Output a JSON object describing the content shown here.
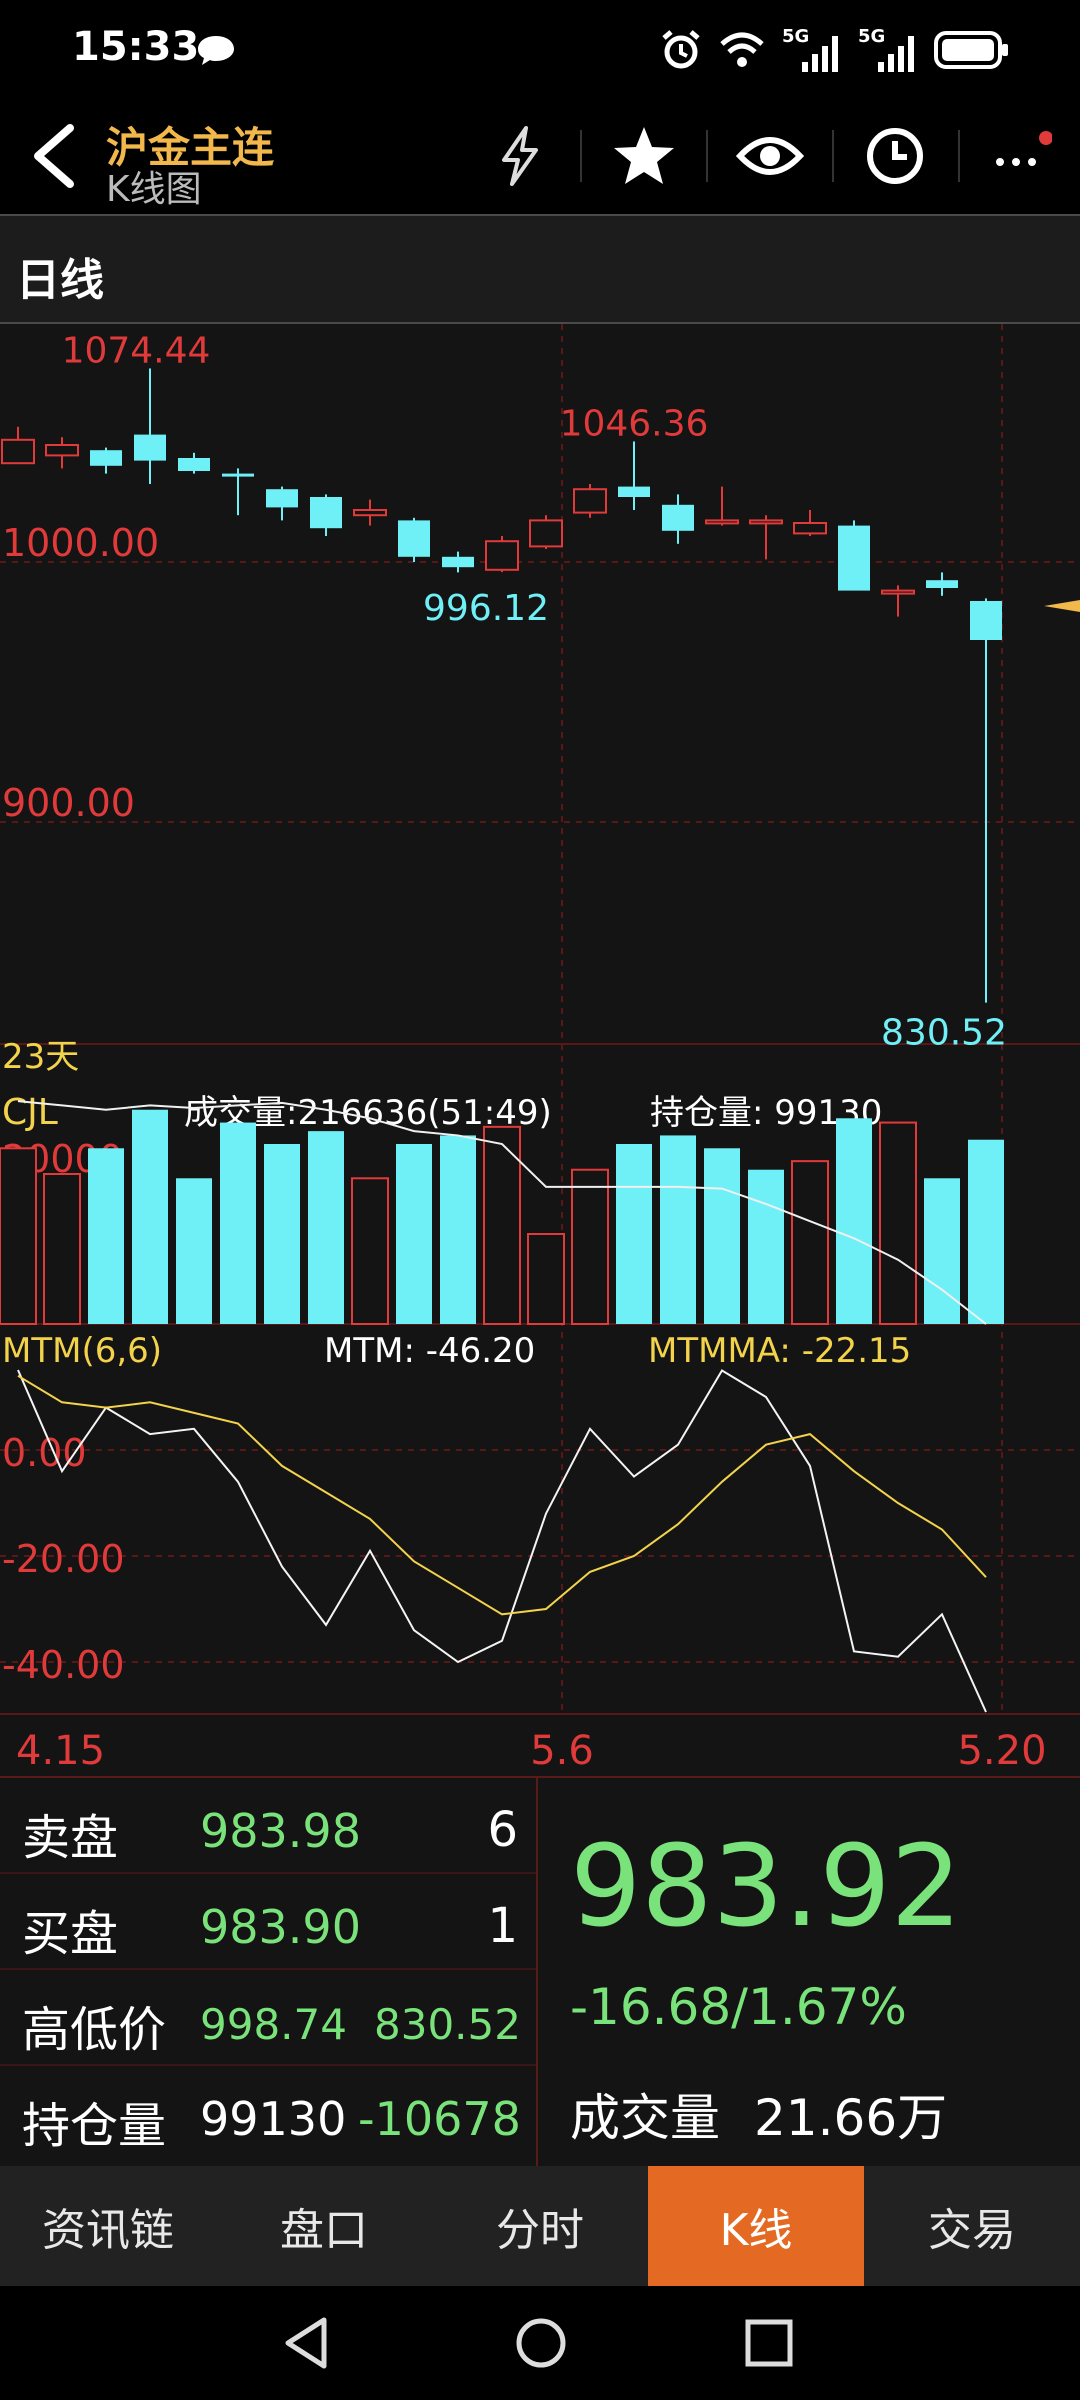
{
  "status_bar": {
    "time": "15:33",
    "net1": "5G",
    "net2": "5G"
  },
  "header": {
    "title": "沪金主连",
    "subtitle": "K线图",
    "icons": [
      "back-icon",
      "lightning-icon",
      "star-icon",
      "eye-icon",
      "clock-icon",
      "more-icon"
    ]
  },
  "period": {
    "label": "日线"
  },
  "chart_data": {
    "type": "candlestick",
    "price_axis": {
      "labels": [
        "1000.00",
        "900.00"
      ],
      "values": [
        1000,
        900
      ]
    },
    "annotations": {
      "high": {
        "text": "1074.44",
        "value": 1074.44,
        "index": 3
      },
      "peak2": {
        "text": "1046.36",
        "value": 1046.36,
        "index": 14
      },
      "low_mid": {
        "text": "996.12",
        "value": 996.12,
        "index": 11
      },
      "low": {
        "text": "830.52",
        "value": 830.52,
        "index": 22
      }
    },
    "days_label": "23天",
    "candles": [
      {
        "o": 1038,
        "h": 1052,
        "l": 1038,
        "c": 1047
      },
      {
        "o": 1041,
        "h": 1048,
        "l": 1036,
        "c": 1045
      },
      {
        "o": 1043,
        "h": 1044,
        "l": 1034,
        "c": 1037
      },
      {
        "o": 1049,
        "h": 1074.44,
        "l": 1030,
        "c": 1039
      },
      {
        "o": 1040,
        "h": 1042,
        "l": 1034,
        "c": 1035
      },
      {
        "o": 1034,
        "h": 1036,
        "l": 1018,
        "c": 1033
      },
      {
        "o": 1028,
        "h": 1029,
        "l": 1016,
        "c": 1021
      },
      {
        "o": 1025,
        "h": 1026,
        "l": 1010,
        "c": 1013
      },
      {
        "o": 1018,
        "h": 1024,
        "l": 1014,
        "c": 1020
      },
      {
        "o": 1016,
        "h": 1017,
        "l": 1000,
        "c": 1002
      },
      {
        "o": 1002,
        "h": 1004,
        "l": 996,
        "c": 998
      },
      {
        "o": 997,
        "h": 1010,
        "l": 996.12,
        "c": 1008
      },
      {
        "o": 1006,
        "h": 1018,
        "l": 1005,
        "c": 1016
      },
      {
        "o": 1019,
        "h": 1030,
        "l": 1017,
        "c": 1028
      },
      {
        "o": 1029,
        "h": 1046.36,
        "l": 1020,
        "c": 1025
      },
      {
        "o": 1022,
        "h": 1026,
        "l": 1007,
        "c": 1012
      },
      {
        "o": 1015,
        "h": 1029,
        "l": 1014,
        "c": 1016
      },
      {
        "o": 1015,
        "h": 1018,
        "l": 1001,
        "c": 1016
      },
      {
        "o": 1011,
        "h": 1020,
        "l": 1010,
        "c": 1015
      },
      {
        "o": 1014,
        "h": 1016,
        "l": 994,
        "c": 989
      },
      {
        "o": 989,
        "h": 991,
        "l": 979,
        "c": 989
      },
      {
        "o": 993,
        "h": 996,
        "l": 987,
        "c": 990
      },
      {
        "o": 985,
        "h": 986,
        "l": 830.52,
        "c": 970
      }
    ],
    "volume": {
      "indicator": "CJL",
      "text": "成交量:216636(51:49)",
      "oi_text": "持仓量: 99130",
      "axis_label": "20000",
      "axis_value": 20000,
      "bars": [
        {
          "v": 20500,
          "up": true
        },
        {
          "v": 17500,
          "up": true
        },
        {
          "v": 20500,
          "up": false
        },
        {
          "v": 25000,
          "up": false
        },
        {
          "v": 17000,
          "up": false
        },
        {
          "v": 23500,
          "up": false
        },
        {
          "v": 21000,
          "up": false
        },
        {
          "v": 22500,
          "up": false
        },
        {
          "v": 17000,
          "up": true
        },
        {
          "v": 21000,
          "up": false
        },
        {
          "v": 22000,
          "up": false
        },
        {
          "v": 23000,
          "up": true
        },
        {
          "v": 10500,
          "up": true
        },
        {
          "v": 18000,
          "up": true
        },
        {
          "v": 21000,
          "up": false
        },
        {
          "v": 22000,
          "up": false
        },
        {
          "v": 20500,
          "up": false
        },
        {
          "v": 18000,
          "up": false
        },
        {
          "v": 19000,
          "up": true
        },
        {
          "v": 24000,
          "up": false
        },
        {
          "v": 23500,
          "up": true
        },
        {
          "v": 17000,
          "up": false
        },
        {
          "v": 21500,
          "up": false
        }
      ],
      "oi_line": [
        26000,
        25500,
        25000,
        25500,
        25200,
        25500,
        25800,
        25000,
        24000,
        22500,
        22000,
        21000,
        16000,
        16000,
        16000,
        16000,
        15800,
        14000,
        12000,
        10000,
        7500,
        4000,
        0
      ],
      "max": 28000
    },
    "mtm": {
      "label": "MTM(6,6)",
      "mtm_text": "MTM: -46.20",
      "mtmma_text": "MTMMA: -22.15",
      "axis_labels": [
        "0.00",
        "-20.00",
        "-40.00"
      ],
      "axis_values": [
        0,
        -20,
        -40
      ],
      "mtm": [
        20,
        -4,
        8,
        3,
        4,
        -6,
        -22,
        -33,
        -19,
        -34,
        -40,
        -36,
        -12,
        4,
        -5,
        1,
        15,
        10,
        -3,
        -38,
        -39,
        -31,
        -51
      ],
      "mtmma": [
        14,
        9,
        8,
        9,
        7,
        5,
        -3,
        -8,
        -13,
        -21,
        -26,
        -31,
        -30,
        -23,
        -20,
        -14,
        -6,
        1,
        3,
        -4,
        -10,
        -15,
        -24
      ],
      "min": -51,
      "max": 22
    },
    "x_labels": [
      {
        "text": "4.15",
        "index": 0
      },
      {
        "text": "5.6",
        "index": 12
      },
      {
        "text": "5.20",
        "index": 22
      }
    ]
  },
  "quote": {
    "ask_label": "卖盘",
    "ask_price": "983.98",
    "ask_qty": "6",
    "bid_label": "买盘",
    "bid_price": "983.90",
    "bid_qty": "1",
    "hl_label": "高低价",
    "high": "998.74",
    "low": "830.52",
    "oi_label": "持仓量",
    "oi": "99130",
    "oi_change": "-10678",
    "last_price": "983.92",
    "change": "-16.68/1.67%",
    "volume_label": "成交量",
    "volume": "21.66万"
  },
  "tabs": [
    {
      "label": "资讯链",
      "active": false
    },
    {
      "label": "盘口",
      "active": false
    },
    {
      "label": "分时",
      "active": false
    },
    {
      "label": "K线",
      "active": true
    },
    {
      "label": "交易",
      "active": false
    }
  ],
  "colors": {
    "up": "#e03a3a",
    "down": "#6ff0f6",
    "accent": "#e46a23",
    "title": "#f2b84b",
    "green": "#7ae27a"
  }
}
